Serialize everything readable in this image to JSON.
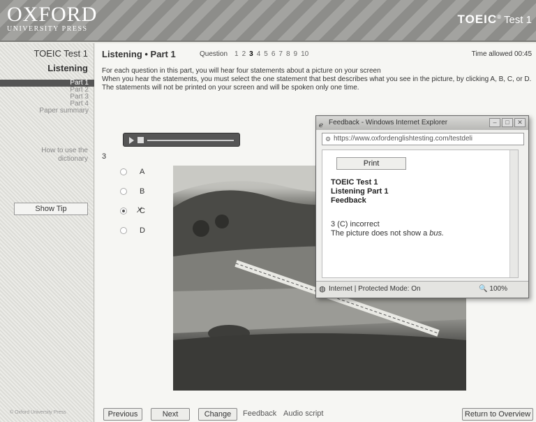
{
  "header": {
    "logo_main": "OXFORD",
    "logo_sub": "UNIVERSITY PRESS",
    "brand": "TOEIC",
    "brand_suffix": "Test 1"
  },
  "sidebar": {
    "title": "TOEIC Test 1",
    "section": "Listening",
    "parts": [
      "Part 1",
      "Part 2",
      "Part 3",
      "Part 4",
      "Paper summary"
    ],
    "active_part": "Part 1",
    "dictionary_link_1": "How to use the",
    "dictionary_link_2": "dictionary",
    "show_tip": "Show Tip",
    "copyright": "© Oxford University Press"
  },
  "main": {
    "title": "Listening • Part 1",
    "question_label": "Question",
    "question_numbers": [
      "1",
      "2",
      "3",
      "4",
      "5",
      "6",
      "7",
      "8",
      "9",
      "10"
    ],
    "current_question": "3",
    "time_allowed": "Time allowed 00:45",
    "instructions": [
      "For each question in this part, you will hear four statements about a picture on your screen",
      "When you hear the statements, you must select the one statement that best describes what you see in the picture, by clicking A, B, C, or D.",
      "The statements will not be printed on your screen and will be spoken only one time."
    ],
    "question_number": "3",
    "options": [
      "A",
      "B",
      "C",
      "D"
    ],
    "selected_option": "C",
    "wrong_mark": "X"
  },
  "footer": {
    "previous": "Previous",
    "next": "Next",
    "change": "Change",
    "feedback": "Feedback",
    "audio_script": "Audio script",
    "return": "Return to Overview"
  },
  "popup": {
    "title": "Feedback - Windows Internet Explorer",
    "url": "https://www.oxfordenglishtesting.com/testdeli",
    "print": "Print",
    "heading_1": "TOEIC Test 1",
    "heading_2": "Listening Part 1",
    "heading_3": "Feedback",
    "result_1": "3 (C) incorrect",
    "result_2_prefix": "The picture does not show a ",
    "result_2_emph": "bus.",
    "status": "Internet | Protected Mode: On",
    "zoom": "100%"
  }
}
